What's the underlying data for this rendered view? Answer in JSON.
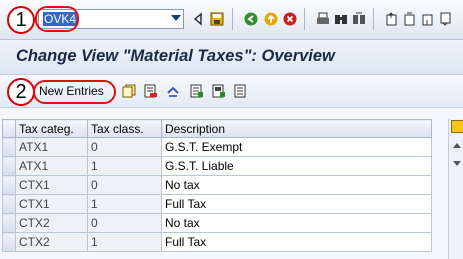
{
  "annotations": {
    "step1": "1",
    "step2": "2"
  },
  "command_field": {
    "value": "OVK4"
  },
  "page_title": "Change View \"Material Taxes\": Overview",
  "app_toolbar": {
    "new_entries_label": "New Entries"
  },
  "table": {
    "columns": [
      "Tax categ.",
      "Tax class.",
      "Description"
    ],
    "rows": [
      {
        "tax_categ": "ATX1",
        "tax_class": "0",
        "description": "G.S.T. Exempt"
      },
      {
        "tax_categ": "ATX1",
        "tax_class": "1",
        "description": "G.S.T. Liable"
      },
      {
        "tax_categ": "CTX1",
        "tax_class": "0",
        "description": "No tax"
      },
      {
        "tax_categ": "CTX1",
        "tax_class": "1",
        "description": "Full Tax"
      },
      {
        "tax_categ": "CTX2",
        "tax_class": "0",
        "description": "No tax"
      },
      {
        "tax_categ": "CTX2",
        "tax_class": "1",
        "description": "Full Tax"
      }
    ]
  },
  "colors": {
    "highlight_ring": "#e01010",
    "selection": "#3169c6"
  }
}
